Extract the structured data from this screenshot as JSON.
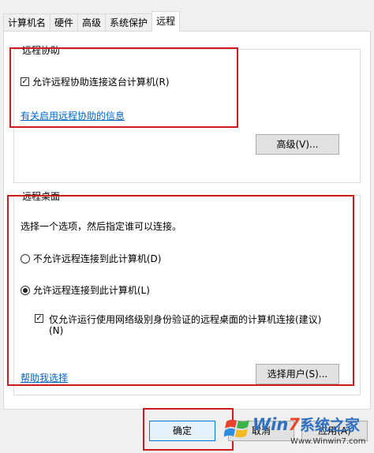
{
  "tabs": [
    "计算机名",
    "硬件",
    "高级",
    "系统保护",
    "远程"
  ],
  "remote_assistance": {
    "title": "远程协助",
    "allow_checkbox_label": "允许远程协助连接这台计算机(R)",
    "allow_checked": true,
    "info_link": "有关启用远程协助的信息",
    "advanced_button": "高级(V)..."
  },
  "remote_desktop": {
    "title": "远程桌面",
    "instruction": "选择一个选项，然后指定谁可以连接。",
    "option_deny": "不允许远程连接到此计算机(D)",
    "option_allow": "允许远程连接到此计算机(L)",
    "selected": "allow",
    "nla_checkbox_line1": "仅允许运行使用网络级别身份验证的远程桌面的计算机连接(建议)",
    "nla_checkbox_line2": "(N)",
    "nla_checked": true,
    "help_link": "帮助我选择",
    "select_users_button": "选择用户(S)..."
  },
  "footer": {
    "ok_button": "确定",
    "cancel_button": "取消",
    "apply_button": "应用(A)"
  },
  "watermark": {
    "brand_a": "Win",
    "brand_b": "7",
    "brand_c": "系统之家",
    "url": "Www.Winwin7.com"
  },
  "colors": {
    "highlight_red": "#d0181f",
    "link_blue": "#0066cc"
  }
}
